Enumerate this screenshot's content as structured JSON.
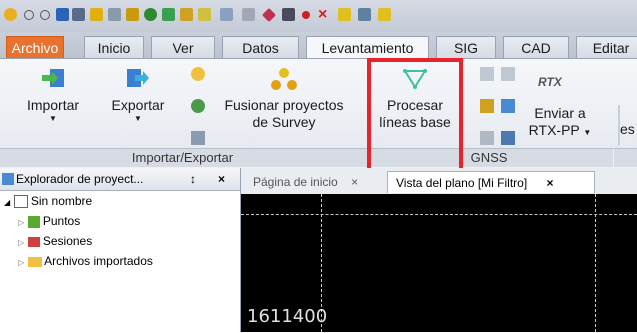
{
  "ribbon_tabs": [
    "Archivo",
    "Inicio",
    "Ver",
    "Datos",
    "Levantamiento",
    "SIG",
    "CAD",
    "Editar"
  ],
  "active_tab": "Levantamiento",
  "groups": {
    "import_export": {
      "label": "Importar/Exportar",
      "import_label": "Importar",
      "export_label": "Exportar",
      "merge_label_line1": "Fusionar proyectos",
      "merge_label_line2": "de Survey"
    },
    "gnss": {
      "label": "GNSS",
      "process_label_line1": "Procesar",
      "process_label_line2": "líneas base",
      "rtx_badge": "RTX",
      "send_label_line1": "Enviar a",
      "send_label_line2": "RTX-PP",
      "cut_label": "es"
    }
  },
  "explorer": {
    "title": "Explorador de proyect...",
    "pin": "↕",
    "close": "×",
    "items": [
      "Sin nombre",
      "Puntos",
      "Sesiones",
      "Archivos importados"
    ]
  },
  "doc_tabs": {
    "home": "Página de inicio",
    "home_close": "×",
    "plan": "Vista del plano [Mi Filtro]",
    "plan_close": "×"
  },
  "plan": {
    "coordinate": "1611400"
  },
  "colors": {
    "file_tab": "#e8722e",
    "highlight": "#e8232b"
  }
}
